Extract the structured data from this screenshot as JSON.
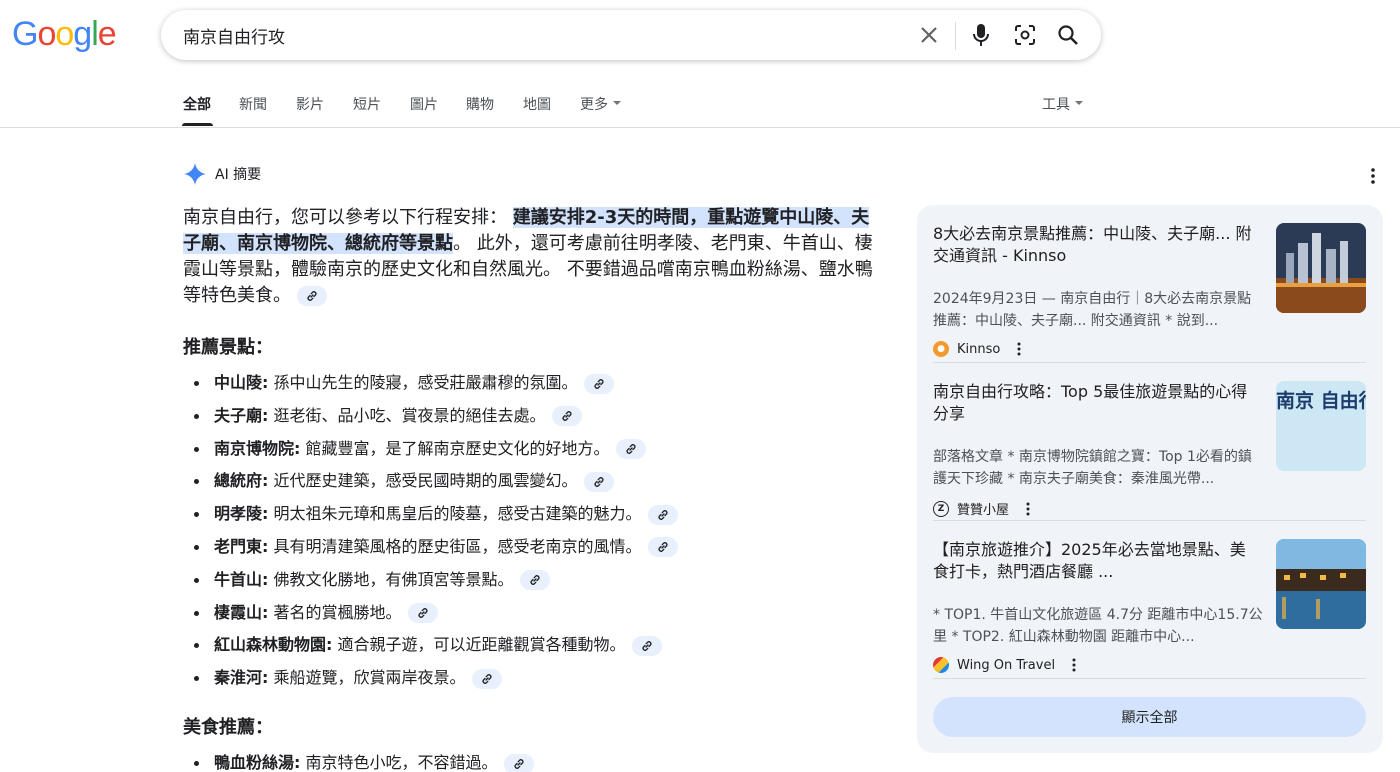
{
  "logo": "Google",
  "search": {
    "query": "南京自由行攻"
  },
  "tabs": [
    "全部",
    "新聞",
    "影片",
    "短片",
    "圖片",
    "購物",
    "地圖",
    "更多"
  ],
  "tools_label": "工具",
  "ai": {
    "heading": "AI 摘要",
    "intro": "南京自由行，您可以參考以下行程安排：",
    "highlight": "建議安排2-3天的時間，重點遊覽中山陵、夫子廟、南京博物院、總統府等景點",
    "rest": "。 此外，還可考慮前往明孝陵、老門東、牛首山、棲霞山等景點，體驗南京的歷史文化和自然風光。 不要錯過品嚐南京鴨血粉絲湯、鹽水鴨等特色美食。"
  },
  "attractions": {
    "heading": "推薦景點：",
    "items": [
      {
        "name": "中山陵:",
        "desc": "孫中山先生的陵寢，感受莊嚴肅穆的氛圍。"
      },
      {
        "name": "夫子廟:",
        "desc": "逛老街、品小吃、賞夜景的絕佳去處。"
      },
      {
        "name": "南京博物院:",
        "desc": "館藏豐富，是了解南京歷史文化的好地方。"
      },
      {
        "name": "總統府:",
        "desc": "近代歷史建築，感受民國時期的風雲變幻。"
      },
      {
        "name": "明孝陵:",
        "desc": "明太祖朱元璋和馬皇后的陵墓，感受古建築的魅力。"
      },
      {
        "name": "老門東:",
        "desc": "具有明清建築風格的歷史街區，感受老南京的風情。"
      },
      {
        "name": "牛首山:",
        "desc": "佛教文化勝地，有佛頂宮等景點。"
      },
      {
        "name": "棲霞山:",
        "desc": "著名的賞楓勝地。"
      },
      {
        "name": "紅山森林動物園:",
        "desc": "適合親子遊，可以近距離觀賞各種動物。"
      },
      {
        "name": "秦淮河:",
        "desc": "乘船遊覽，欣賞兩岸夜景。"
      }
    ]
  },
  "food": {
    "heading": "美食推薦：",
    "items": [
      {
        "name": "鴨血粉絲湯:",
        "desc": "南京特色小吃，不容錯過。"
      }
    ]
  },
  "sources": [
    {
      "title": "8大必去南京景點推薦：中山陵、夫子廟... 附交通資訊 - Kinnso",
      "snippet": "2024年9月23日 — 南京自由行｜8大必去南京景點推薦：中山陵、夫子廟... 附交通資訊 * 說到...",
      "site": "Kinnso"
    },
    {
      "title": "南京自由行攻略：Top 5最佳旅遊景點的心得分享",
      "snippet": "部落格文章 * 南京博物院鎮館之寶：Top 1必看的鎮護天下珍藏 * 南京夫子廟美食：秦淮風光帶...",
      "site": "贊贊小屋",
      "thumb_text": "南京 自由行攻略"
    },
    {
      "title": "【南京旅遊推介】2025年必去當地景點、美食打卡，熱門酒店餐廳 ...",
      "snippet": "* TOP1. 牛首山文化旅遊區 4.7分 距離市中心15.7公里 * TOP2. 紅山森林動物園 距離市中心...",
      "site": "Wing On Travel"
    }
  ],
  "show_all": "顯示全部",
  "colors": {
    "accent": "#1a73e8",
    "panel": "#f0f4f9",
    "highlight": "#d3e3fd"
  }
}
